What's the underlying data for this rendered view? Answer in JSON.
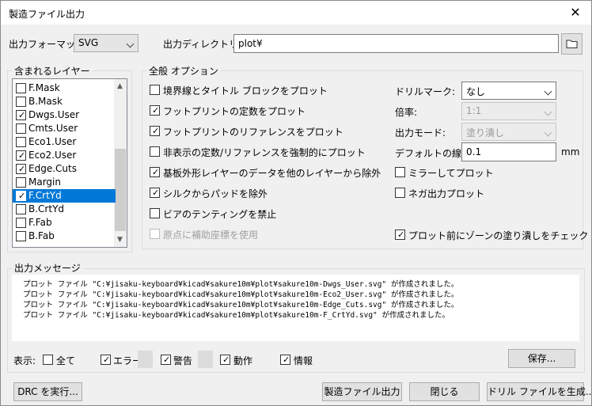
{
  "window": {
    "title": "製造ファイル出力",
    "close": "✕"
  },
  "top": {
    "format_label": "出力フォーマット:",
    "format_value": "SVG",
    "dir_label": "出力ディレクトリー:",
    "dir_value": "plot¥"
  },
  "layers": {
    "title": "含まれるレイヤー",
    "items": [
      {
        "label": "F.Mask",
        "checked": false,
        "selected": false
      },
      {
        "label": "B.Mask",
        "checked": false,
        "selected": false
      },
      {
        "label": "Dwgs.User",
        "checked": true,
        "selected": false
      },
      {
        "label": "Cmts.User",
        "checked": false,
        "selected": false
      },
      {
        "label": "Eco1.User",
        "checked": false,
        "selected": false
      },
      {
        "label": "Eco2.User",
        "checked": true,
        "selected": false
      },
      {
        "label": "Edge.Cuts",
        "checked": true,
        "selected": false
      },
      {
        "label": "Margin",
        "checked": false,
        "selected": false
      },
      {
        "label": "F.CrtYd",
        "checked": true,
        "selected": true
      },
      {
        "label": "B.CrtYd",
        "checked": false,
        "selected": false
      },
      {
        "label": "F.Fab",
        "checked": false,
        "selected": false
      },
      {
        "label": "B.Fab",
        "checked": false,
        "selected": false
      }
    ]
  },
  "general": {
    "title": "全般 オプション",
    "options": [
      {
        "label": "境界線とタイトル ブロックをプロット",
        "checked": false,
        "disabled": false
      },
      {
        "label": "フットプリントの定数をプロット",
        "checked": true,
        "disabled": false
      },
      {
        "label": "フットプリントのリファレンスをプロット",
        "checked": true,
        "disabled": false
      },
      {
        "label": "非表示の定数/リファレンスを強制的にプロット",
        "checked": false,
        "disabled": false
      },
      {
        "label": "基板外形レイヤーのデータを他のレイヤーから除外",
        "checked": true,
        "disabled": false
      },
      {
        "label": "シルクからパッドを除外",
        "checked": true,
        "disabled": false
      },
      {
        "label": "ビアのテンティングを禁止",
        "checked": false,
        "disabled": false
      },
      {
        "label": "原点に補助座標を使用",
        "checked": false,
        "disabled": true
      }
    ],
    "drill_label": "ドリルマーク:",
    "drill_value": "なし",
    "scale_label": "倍率:",
    "scale_value": "1:1",
    "mode_label": "出力モード:",
    "mode_value": "塗り潰し",
    "width_label": "デフォルトの線幅:",
    "width_value": "0.1",
    "width_unit": "mm",
    "mirror_label": "ミラーしてプロット",
    "mirror_checked": false,
    "negative_label": "ネガ出力プロット",
    "negative_checked": false,
    "zonefill_label": "プロット前にゾーンの塗り潰しをチェック",
    "zonefill_checked": true
  },
  "messages": {
    "title": "出力メッセージ",
    "lines": [
      "プロット ファイル \"C:¥jisaku-keyboard¥kicad¥sakure10m¥plot¥sakure10m-Dwgs_User.svg\" が作成されました。",
      "プロット ファイル \"C:¥jisaku-keyboard¥kicad¥sakure10m¥plot¥sakure10m-Eco2_User.svg\" が作成されました。",
      "プロット ファイル \"C:¥jisaku-keyboard¥kicad¥sakure10m¥plot¥sakure10m-Edge_Cuts.svg\" が作成されました。",
      "プロット ファイル \"C:¥jisaku-keyboard¥kicad¥sakure10m¥plot¥sakure10m-F_CrtYd.svg\" が作成されました。"
    ],
    "show_label": "表示:",
    "filter_all": "全て",
    "filter_all_checked": false,
    "filter_error": "エラー",
    "filter_error_checked": true,
    "filter_warning": "警告",
    "filter_warning_checked": true,
    "filter_action": "動作",
    "filter_action_checked": true,
    "filter_info": "情報",
    "filter_info_checked": true,
    "save_label": "保存..."
  },
  "buttons": {
    "drc": "DRC を実行...",
    "plot": "製造ファイル出力",
    "close": "閉じる",
    "drill": "ドリル ファイルを生成..."
  },
  "colors": {
    "selection": "#0078d7",
    "dialog_bg": "#f0f0f0"
  }
}
